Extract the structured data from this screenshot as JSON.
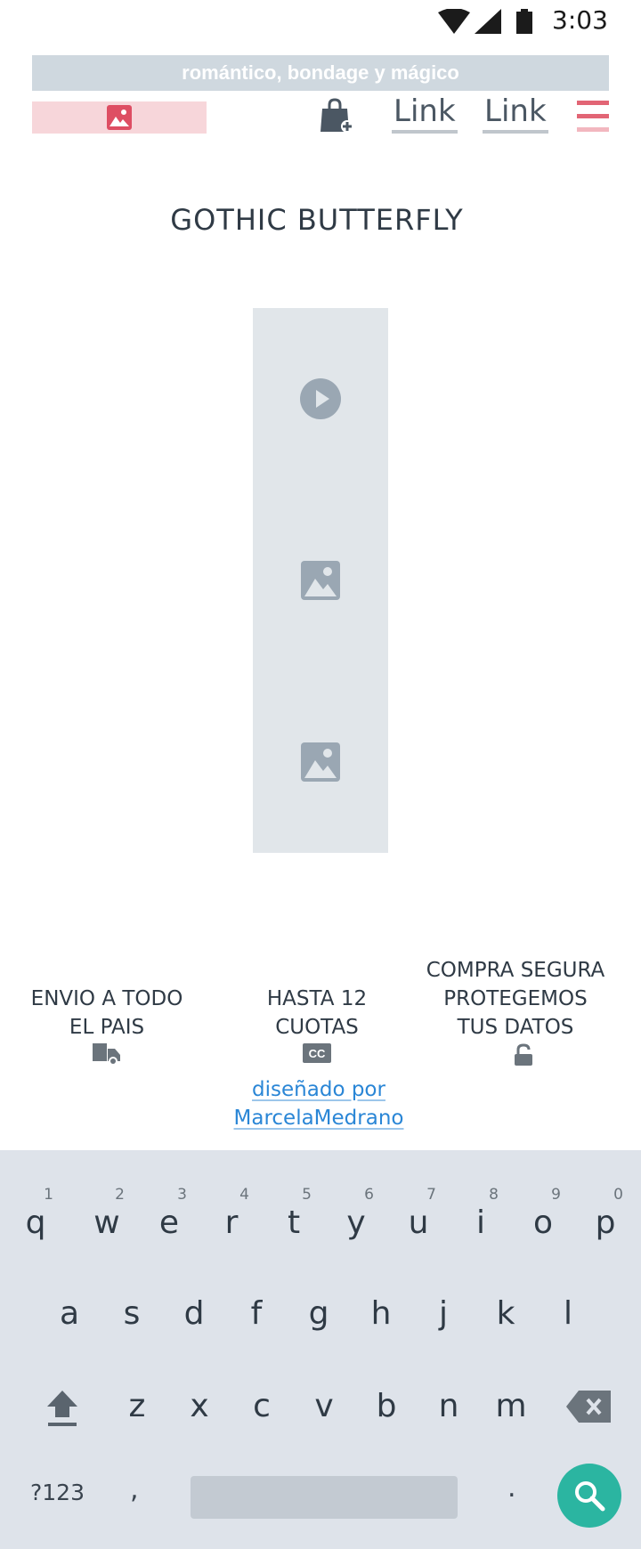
{
  "status_bar": {
    "time": "3:03",
    "icons": [
      "wifi-icon",
      "signal-icon",
      "battery-icon"
    ]
  },
  "header": {
    "tagline": "romántico, bondage y mágico",
    "logo_icon": "image-icon",
    "cart_icon": "shopping-bag-add-icon",
    "nav_links": [
      "Link",
      "Link"
    ],
    "menu_icon": "hamburger-menu-icon"
  },
  "main": {
    "title": "GOTHIC BUTTERFLY",
    "media": [
      "play-icon",
      "image-icon",
      "image-icon"
    ]
  },
  "features": [
    {
      "label": "ENVIO A TODO\nEL PAIS",
      "icon": "truck-icon"
    },
    {
      "label": "HASTA 12\nCUOTAS",
      "icon": "credit-card-icon"
    },
    {
      "label": "COMPRA SEGURA\nPROTEGEMOS\nTUS DATOS",
      "icon": "lock-icon"
    }
  ],
  "credit": {
    "text": "diseñado por\nMarcelaMedrano"
  },
  "keyboard": {
    "row1": [
      {
        "key": "q",
        "hint": "1"
      },
      {
        "key": "w",
        "hint": "2"
      },
      {
        "key": "e",
        "hint": "3"
      },
      {
        "key": "r",
        "hint": "4"
      },
      {
        "key": "t",
        "hint": "5"
      },
      {
        "key": "y",
        "hint": "6"
      },
      {
        "key": "u",
        "hint": "7"
      },
      {
        "key": "i",
        "hint": "8"
      },
      {
        "key": "o",
        "hint": "9"
      },
      {
        "key": "p",
        "hint": "0"
      }
    ],
    "row2": [
      "a",
      "s",
      "d",
      "f",
      "g",
      "h",
      "j",
      "k",
      "l"
    ],
    "row3": [
      "z",
      "x",
      "c",
      "v",
      "b",
      "n",
      "m"
    ],
    "num_label": "?123",
    "comma": ",",
    "period": ".",
    "colors": {
      "background": "#dee3ea",
      "search": "#2bb5a1",
      "space": "#c3cad2"
    }
  },
  "colors": {
    "accent": "#e26575",
    "link": "#2a86d6",
    "placeholder": "#e1e6ea"
  }
}
